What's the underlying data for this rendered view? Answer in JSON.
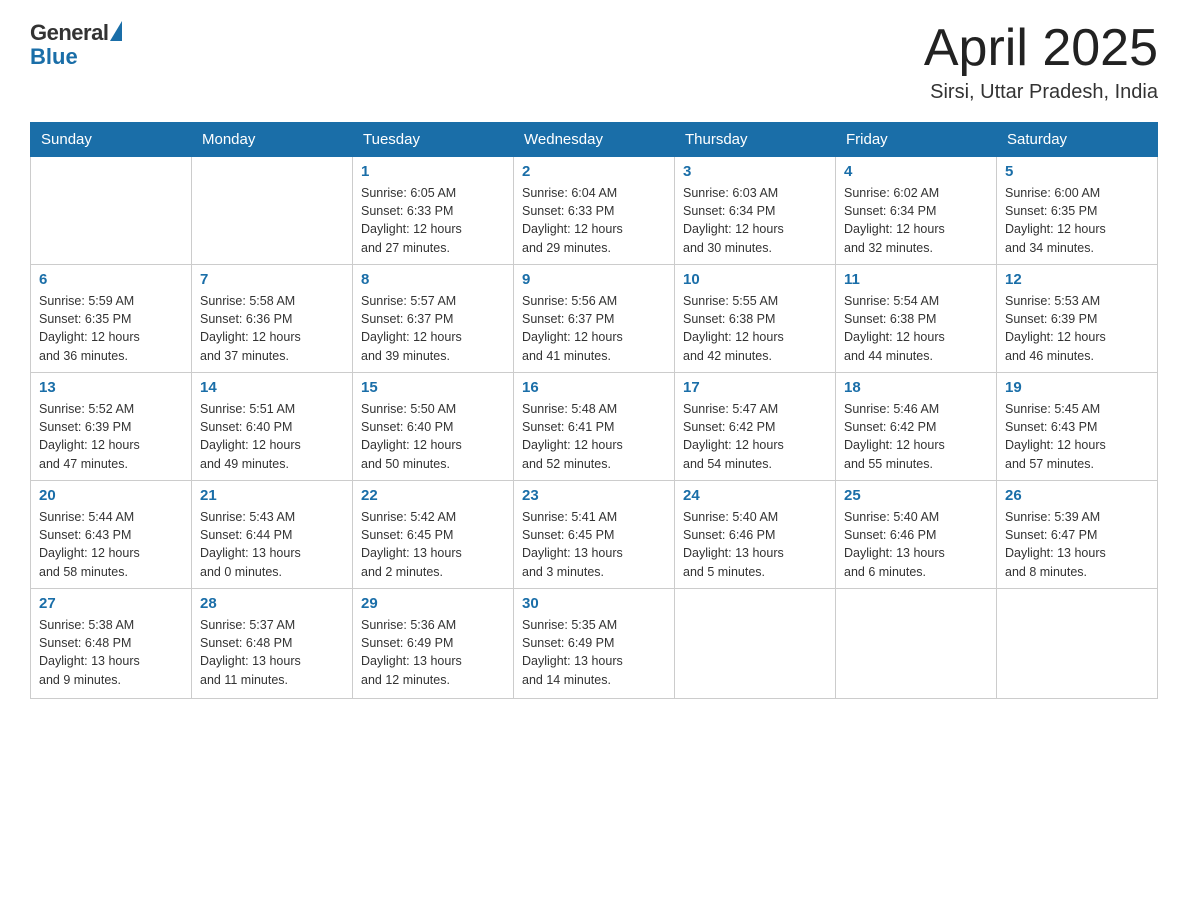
{
  "logo": {
    "general": "General",
    "blue": "Blue"
  },
  "title": "April 2025",
  "subtitle": "Sirsi, Uttar Pradesh, India",
  "days": [
    "Sunday",
    "Monday",
    "Tuesday",
    "Wednesday",
    "Thursday",
    "Friday",
    "Saturday"
  ],
  "weeks": [
    [
      {
        "num": "",
        "info": ""
      },
      {
        "num": "",
        "info": ""
      },
      {
        "num": "1",
        "info": "Sunrise: 6:05 AM\nSunset: 6:33 PM\nDaylight: 12 hours\nand 27 minutes."
      },
      {
        "num": "2",
        "info": "Sunrise: 6:04 AM\nSunset: 6:33 PM\nDaylight: 12 hours\nand 29 minutes."
      },
      {
        "num": "3",
        "info": "Sunrise: 6:03 AM\nSunset: 6:34 PM\nDaylight: 12 hours\nand 30 minutes."
      },
      {
        "num": "4",
        "info": "Sunrise: 6:02 AM\nSunset: 6:34 PM\nDaylight: 12 hours\nand 32 minutes."
      },
      {
        "num": "5",
        "info": "Sunrise: 6:00 AM\nSunset: 6:35 PM\nDaylight: 12 hours\nand 34 minutes."
      }
    ],
    [
      {
        "num": "6",
        "info": "Sunrise: 5:59 AM\nSunset: 6:35 PM\nDaylight: 12 hours\nand 36 minutes."
      },
      {
        "num": "7",
        "info": "Sunrise: 5:58 AM\nSunset: 6:36 PM\nDaylight: 12 hours\nand 37 minutes."
      },
      {
        "num": "8",
        "info": "Sunrise: 5:57 AM\nSunset: 6:37 PM\nDaylight: 12 hours\nand 39 minutes."
      },
      {
        "num": "9",
        "info": "Sunrise: 5:56 AM\nSunset: 6:37 PM\nDaylight: 12 hours\nand 41 minutes."
      },
      {
        "num": "10",
        "info": "Sunrise: 5:55 AM\nSunset: 6:38 PM\nDaylight: 12 hours\nand 42 minutes."
      },
      {
        "num": "11",
        "info": "Sunrise: 5:54 AM\nSunset: 6:38 PM\nDaylight: 12 hours\nand 44 minutes."
      },
      {
        "num": "12",
        "info": "Sunrise: 5:53 AM\nSunset: 6:39 PM\nDaylight: 12 hours\nand 46 minutes."
      }
    ],
    [
      {
        "num": "13",
        "info": "Sunrise: 5:52 AM\nSunset: 6:39 PM\nDaylight: 12 hours\nand 47 minutes."
      },
      {
        "num": "14",
        "info": "Sunrise: 5:51 AM\nSunset: 6:40 PM\nDaylight: 12 hours\nand 49 minutes."
      },
      {
        "num": "15",
        "info": "Sunrise: 5:50 AM\nSunset: 6:40 PM\nDaylight: 12 hours\nand 50 minutes."
      },
      {
        "num": "16",
        "info": "Sunrise: 5:48 AM\nSunset: 6:41 PM\nDaylight: 12 hours\nand 52 minutes."
      },
      {
        "num": "17",
        "info": "Sunrise: 5:47 AM\nSunset: 6:42 PM\nDaylight: 12 hours\nand 54 minutes."
      },
      {
        "num": "18",
        "info": "Sunrise: 5:46 AM\nSunset: 6:42 PM\nDaylight: 12 hours\nand 55 minutes."
      },
      {
        "num": "19",
        "info": "Sunrise: 5:45 AM\nSunset: 6:43 PM\nDaylight: 12 hours\nand 57 minutes."
      }
    ],
    [
      {
        "num": "20",
        "info": "Sunrise: 5:44 AM\nSunset: 6:43 PM\nDaylight: 12 hours\nand 58 minutes."
      },
      {
        "num": "21",
        "info": "Sunrise: 5:43 AM\nSunset: 6:44 PM\nDaylight: 13 hours\nand 0 minutes."
      },
      {
        "num": "22",
        "info": "Sunrise: 5:42 AM\nSunset: 6:45 PM\nDaylight: 13 hours\nand 2 minutes."
      },
      {
        "num": "23",
        "info": "Sunrise: 5:41 AM\nSunset: 6:45 PM\nDaylight: 13 hours\nand 3 minutes."
      },
      {
        "num": "24",
        "info": "Sunrise: 5:40 AM\nSunset: 6:46 PM\nDaylight: 13 hours\nand 5 minutes."
      },
      {
        "num": "25",
        "info": "Sunrise: 5:40 AM\nSunset: 6:46 PM\nDaylight: 13 hours\nand 6 minutes."
      },
      {
        "num": "26",
        "info": "Sunrise: 5:39 AM\nSunset: 6:47 PM\nDaylight: 13 hours\nand 8 minutes."
      }
    ],
    [
      {
        "num": "27",
        "info": "Sunrise: 5:38 AM\nSunset: 6:48 PM\nDaylight: 13 hours\nand 9 minutes."
      },
      {
        "num": "28",
        "info": "Sunrise: 5:37 AM\nSunset: 6:48 PM\nDaylight: 13 hours\nand 11 minutes."
      },
      {
        "num": "29",
        "info": "Sunrise: 5:36 AM\nSunset: 6:49 PM\nDaylight: 13 hours\nand 12 minutes."
      },
      {
        "num": "30",
        "info": "Sunrise: 5:35 AM\nSunset: 6:49 PM\nDaylight: 13 hours\nand 14 minutes."
      },
      {
        "num": "",
        "info": ""
      },
      {
        "num": "",
        "info": ""
      },
      {
        "num": "",
        "info": ""
      }
    ]
  ]
}
